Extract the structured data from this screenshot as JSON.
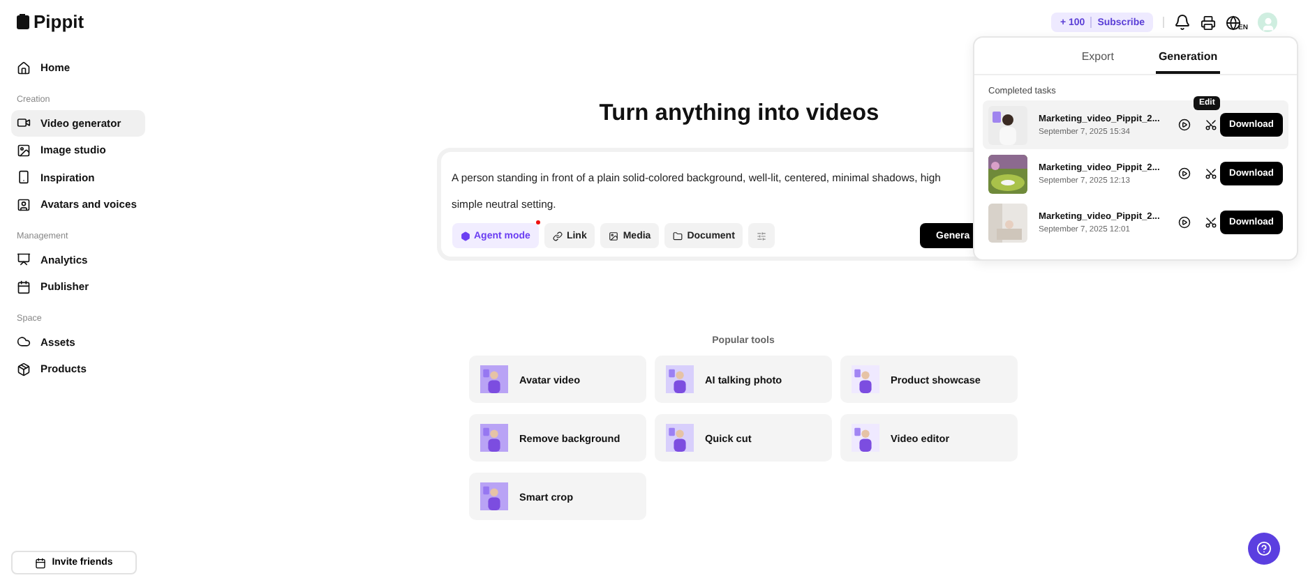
{
  "brand": "Pippit",
  "sidebar": {
    "items": [
      {
        "kind": "item",
        "label": "Home",
        "selected": false
      },
      {
        "kind": "section",
        "label": "Creation"
      },
      {
        "kind": "item",
        "label": "Video generator",
        "selected": true
      },
      {
        "kind": "item",
        "label": "Image studio",
        "selected": false
      },
      {
        "kind": "item",
        "label": "Inspiration",
        "selected": false
      },
      {
        "kind": "item",
        "label": "Avatars and voices",
        "selected": false
      },
      {
        "kind": "section",
        "label": "Management"
      },
      {
        "kind": "item",
        "label": "Analytics",
        "selected": false
      },
      {
        "kind": "item",
        "label": "Publisher",
        "selected": false
      },
      {
        "kind": "section",
        "label": "Space"
      },
      {
        "kind": "item",
        "label": "Assets",
        "selected": false
      },
      {
        "kind": "item",
        "label": "Products",
        "selected": false
      }
    ],
    "invite": "Invite friends"
  },
  "topbar": {
    "credits": "+ 100",
    "subscribe": "Subscribe",
    "language": "EN"
  },
  "title": "Turn anything into videos",
  "prompt": {
    "lines": [
      "A person standing in front of a plain solid-colored background, well-lit, centered, minimal shadows, high",
      "simple neutral setting."
    ],
    "chips": [
      {
        "kind": "agent",
        "label": "Agent mode",
        "dot": true
      },
      {
        "kind": "link",
        "label": "Link"
      },
      {
        "kind": "media",
        "label": "Media"
      },
      {
        "kind": "document",
        "label": "Document"
      },
      {
        "kind": "settings"
      }
    ],
    "generate": "Genera"
  },
  "popular": {
    "title": "Popular tools",
    "tools": [
      "Avatar video",
      "AI talking photo",
      "Product showcase",
      "Remove background",
      "Quick cut",
      "Video editor",
      "Smart crop"
    ]
  },
  "tasks_panel": {
    "tabs": [
      {
        "label": "Export",
        "selected": false
      },
      {
        "label": "Generation",
        "selected": true
      }
    ],
    "heading": "Completed tasks",
    "tooltip": "Edit",
    "tasks": [
      {
        "name": "Marketing_video_Pippit_2...",
        "date": "September 7, 2025 15:34",
        "button": "Download",
        "highlighted": true
      },
      {
        "name": "Marketing_video_Pippit_2...",
        "date": "September 7, 2025 12:13",
        "button": "Download",
        "highlighted": false
      },
      {
        "name": "Marketing_video_Pippit_2...",
        "date": "September 7, 2025 12:01",
        "button": "Download",
        "highlighted": false
      }
    ]
  }
}
